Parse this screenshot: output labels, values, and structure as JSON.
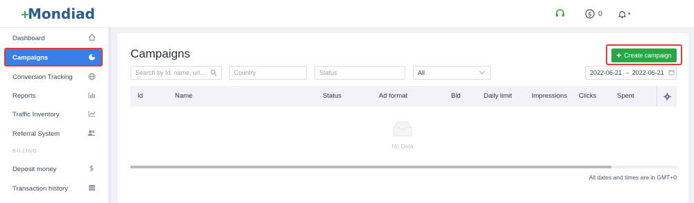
{
  "app": {
    "brand": "Mondiad"
  },
  "header": {
    "balance": "0",
    "icons": [
      "headset-icon",
      "dollar-icon",
      "bell-icon"
    ]
  },
  "sidebar": {
    "items": [
      {
        "label": "Dashboard",
        "icon": "home-icon"
      },
      {
        "label": "Campaigns",
        "icon": "pie-chart-icon",
        "active": true
      },
      {
        "label": "Conversion Tracking",
        "icon": "globe-icon"
      },
      {
        "label": "Reports",
        "icon": "bar-chart-icon"
      },
      {
        "label": "Traffic Inventory",
        "icon": "line-chart-icon"
      },
      {
        "label": "Referral System",
        "icon": "users-icon"
      },
      {
        "label": "Deposit money",
        "icon": "dollar-sign-icon"
      },
      {
        "label": "Transaction history",
        "icon": "table-icon"
      }
    ],
    "section_billing": "BILLING"
  },
  "main": {
    "title": "Campaigns",
    "create_button": "Create campaign",
    "filters": {
      "search_placeholder": "Search by Id, name, url...",
      "country_placeholder": "Country",
      "status_placeholder": "Status",
      "type_value": "All",
      "date_from": "2022-06-21",
      "date_to": "2022-06-21",
      "date_arrow": "→"
    },
    "table": {
      "columns": [
        "Id",
        "Name",
        "Status",
        "Ad format",
        "Bid",
        "Daily limit",
        "Impressions",
        "Clicks",
        "Spent"
      ],
      "empty_text": "No Data"
    },
    "footnote": "All dates and times are in GMT+0"
  },
  "colors": {
    "accent": "#3b7ee6",
    "create": "#27a745",
    "highlight": "#e03a3a",
    "brand": "#2b5e8e"
  }
}
